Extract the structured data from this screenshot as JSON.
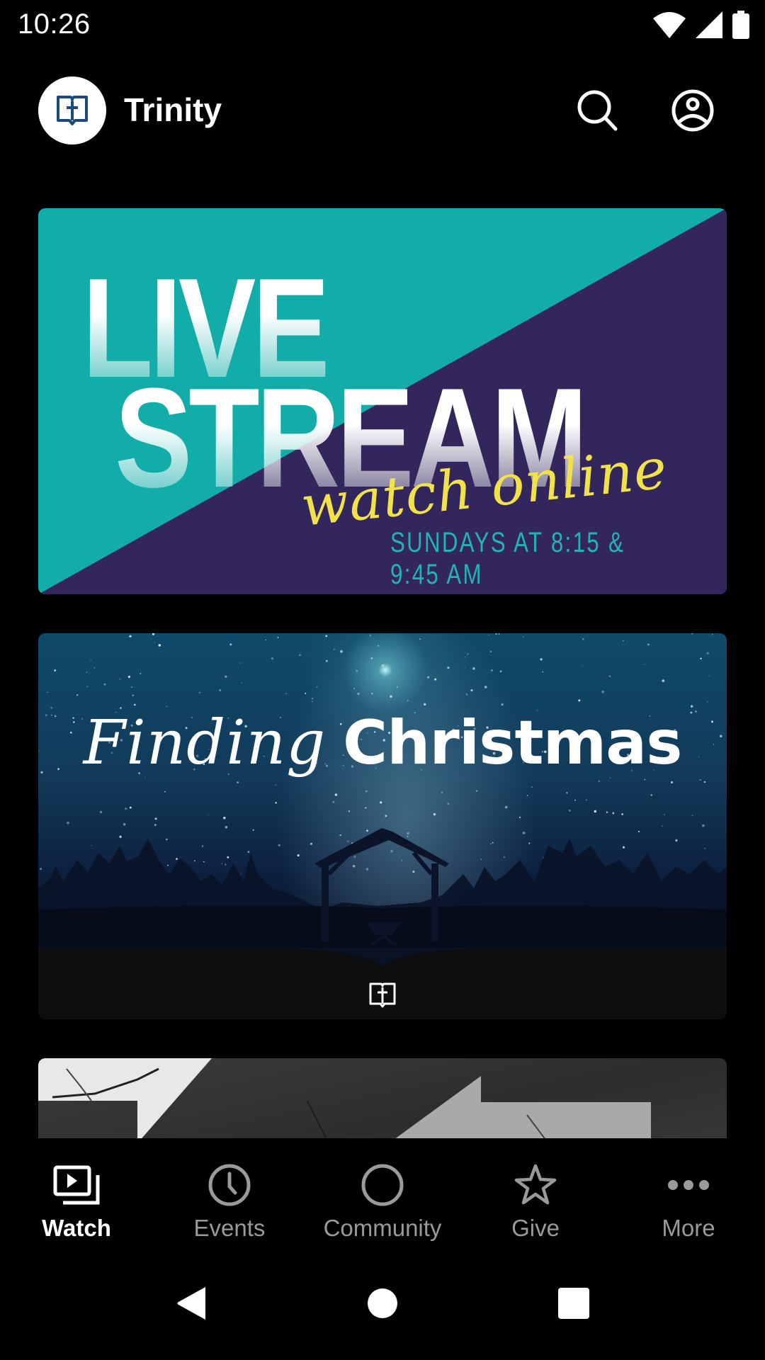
{
  "status_bar": {
    "time": "10:26",
    "icons": [
      "wifi-icon",
      "cellular-signal-icon",
      "battery-icon"
    ]
  },
  "header": {
    "app_title": "Trinity",
    "logo_icon": "bible-cross-icon",
    "actions": [
      {
        "name": "search",
        "icon": "search-icon"
      },
      {
        "name": "profile",
        "icon": "account-circle-icon"
      }
    ]
  },
  "feed": {
    "cards": [
      {
        "kind": "livestream",
        "headline_line1": "LIVE",
        "headline_line2": "STREAM",
        "script_text": "watch online",
        "subtitle": "SUNDAYS AT 8:15 & 9:45 AM",
        "colors": {
          "teal": "#12ada9",
          "purple": "#33265c",
          "yellow": "#f1e24a",
          "subtitle": "#22b3b8"
        }
      },
      {
        "kind": "series",
        "title_italic": "Finding",
        "title_bold": "Christmas",
        "footer_icon": "bible-cross-icon"
      },
      {
        "kind": "series-partial",
        "image": "cracked-concrete-texture"
      }
    ]
  },
  "bottom_nav": {
    "items": [
      {
        "label": "Watch",
        "icon": "watch-video-icon",
        "active": true
      },
      {
        "label": "Events",
        "icon": "clock-icon",
        "active": false
      },
      {
        "label": "Community",
        "icon": "circle-icon",
        "active": false
      },
      {
        "label": "Give",
        "icon": "star-icon",
        "active": false
      },
      {
        "label": "More",
        "icon": "more-horizontal-icon",
        "active": false
      }
    ],
    "active_color": "#ffffff",
    "inactive_color": "#9a9a9a"
  },
  "system_nav": {
    "buttons": [
      "back",
      "home",
      "recents"
    ]
  }
}
